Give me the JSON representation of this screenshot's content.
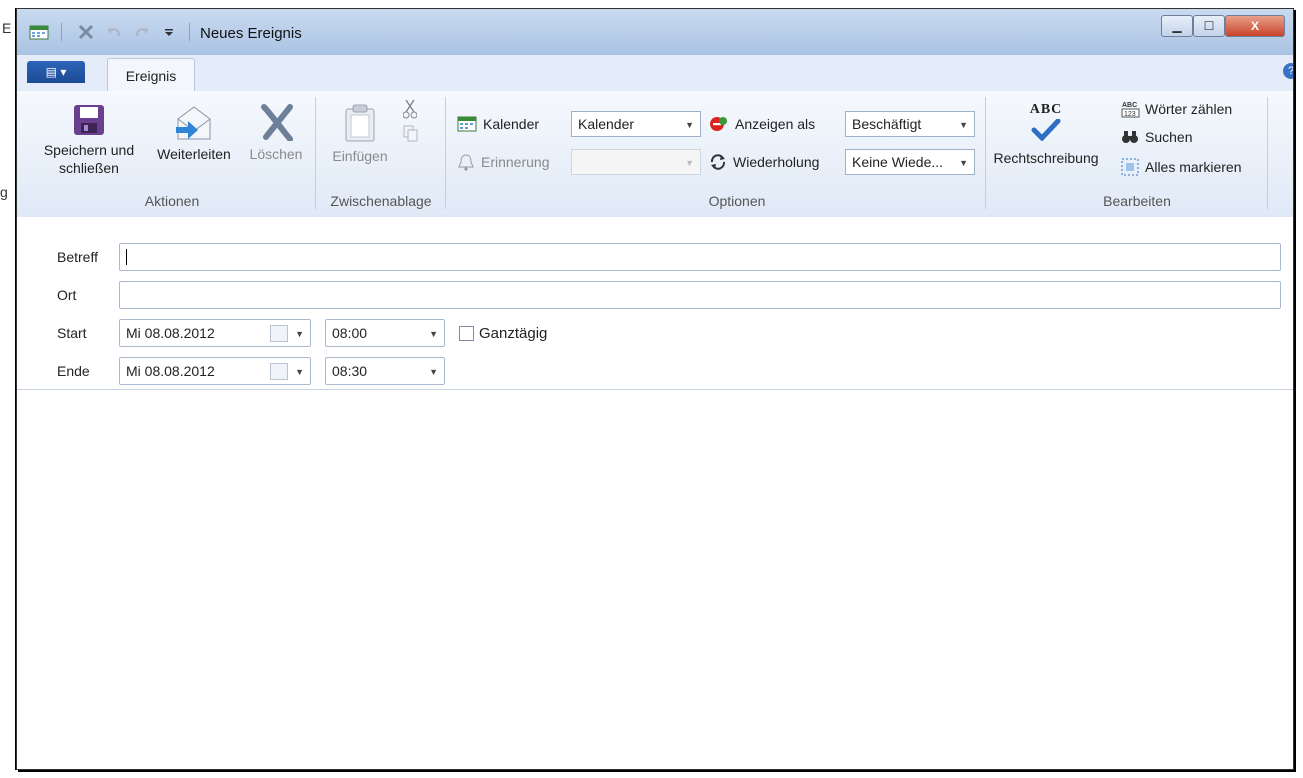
{
  "window": {
    "title": "Neues Ereignis",
    "left_edge_text": "E",
    "left_edge_text2": "g",
    "buttons": {
      "minimize": "▁",
      "maximize": "☐",
      "close": "X"
    }
  },
  "tabs": {
    "file_menu": "▤ ▾",
    "active": "Ereignis",
    "help": "?"
  },
  "ribbon": {
    "groups": {
      "aktionen": "Aktionen",
      "zwischenablage": "Zwischenablage",
      "optionen": "Optionen",
      "bearbeiten": "Bearbeiten"
    },
    "save_label_1": "Speichern und",
    "save_label_2": "schließen",
    "forward_label": "Weiterleiten",
    "delete_label": "Löschen",
    "paste_label": "Einfügen",
    "calendar_label": "Kalender",
    "calendar_value": "Kalender",
    "reminder_label": "Erinnerung",
    "show_as_label": "Anzeigen als",
    "show_as_value": "Beschäftigt",
    "recurrence_label": "Wiederholung",
    "recurrence_value": "Keine Wiede...",
    "spelling_label": "Rechtschreibung",
    "spelling_icon_text": "ABC",
    "word_count_label": "Wörter zählen",
    "search_label": "Suchen",
    "select_all_label": "Alles markieren"
  },
  "form": {
    "subject_label": "Betreff",
    "subject_value": "",
    "location_label": "Ort",
    "location_value": "",
    "start_label": "Start",
    "start_date": "Mi 08.08.2012",
    "start_time": "08:00",
    "allday_label": "Ganztägig",
    "allday_checked": false,
    "end_label": "Ende",
    "end_date": "Mi 08.08.2012",
    "end_time": "08:30"
  },
  "colors": {
    "titlebar": "#bcd0ea",
    "file_tab": "#1f52a0",
    "ribbon": "#e8eff9",
    "save_icon": "#6a3f8f",
    "forward_arrow": "#2f86d6"
  }
}
